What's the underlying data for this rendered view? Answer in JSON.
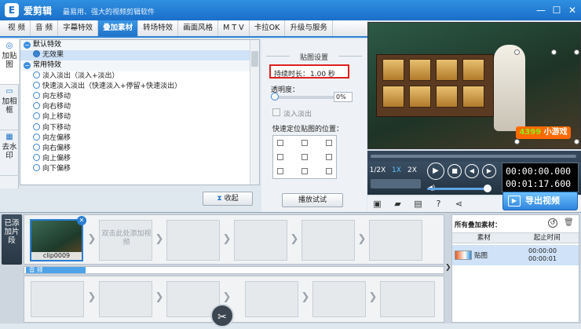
{
  "app": {
    "title": "爱剪辑",
    "slogan": "最易用、强大的视频剪辑软件",
    "logo": "E"
  },
  "window": {
    "min": "—",
    "max": "☐",
    "close": "✕"
  },
  "tabs": [
    {
      "label": "视 频"
    },
    {
      "label": "音 频"
    },
    {
      "label": "字幕特效"
    },
    {
      "label": "叠加素材",
      "active": true
    },
    {
      "label": "转场特效"
    },
    {
      "label": "画面风格"
    },
    {
      "label": "M T V"
    },
    {
      "label": "卡拉OK"
    },
    {
      "label": "升级与服务"
    }
  ],
  "side_tabs": [
    {
      "label": "加贴图",
      "icon": "sticker-icon",
      "active": true
    },
    {
      "label": "加相框",
      "icon": "frame-icon"
    },
    {
      "label": "去水印",
      "icon": "watermark-icon"
    }
  ],
  "effects": {
    "group_default": "默认特效",
    "none": "无效果",
    "group_common": "常用特效",
    "items": [
      "淡入淡出（淡入+淡出）",
      "快速淡入淡出（快速淡入+停留+快速淡出）",
      "向左移动",
      "向右移动",
      "向上移动",
      "向下移动",
      "向左偏移",
      "向右偏移",
      "向上偏移",
      "向下偏移"
    ]
  },
  "collapse_label": "收起",
  "settings": {
    "title": "贴图设置",
    "duration_label": "持续时长：",
    "duration_value": "1.00 秒",
    "opacity_label": "透明度：",
    "opacity_value": "0%",
    "fade_label": "淡入淡出",
    "position_label": "快速定位贴图的位置：",
    "preview_label": "播放试试"
  },
  "player": {
    "speeds": [
      "1/2X",
      "1X",
      "2X"
    ],
    "active_speed": "1X",
    "current_time": "00:00:00.000",
    "total_time": "00:01:17.600",
    "volume": 0.9
  },
  "export_label": "导出视频",
  "bottom": {
    "added_label": "已添加片段",
    "clip_name": "clip0009",
    "add_hint": "双击此处添加视频",
    "audio_label": "音 频",
    "overlay_title": "所有叠加素材：",
    "overlay_cols": [
      "素材",
      "起止时间"
    ],
    "overlay_row": {
      "name": "贴图",
      "start": "00:00:00",
      "end": "00:00:01"
    }
  },
  "preview": {
    "logo_num": "4399",
    "logo_text": "小游戏"
  }
}
